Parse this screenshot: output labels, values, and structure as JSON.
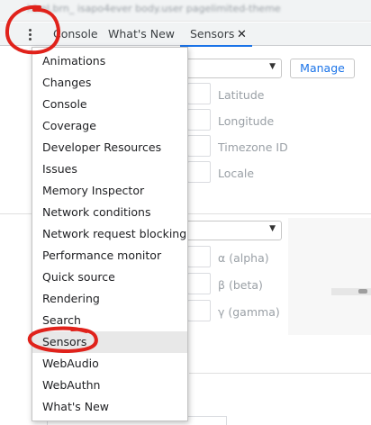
{
  "top_strip": {
    "breadcrumb_text": "html.brn_ isapo4ever  body.user pagelimited-theme"
  },
  "tabs": [
    {
      "label": "Console"
    },
    {
      "label": "What's New"
    },
    {
      "label": "Sensors",
      "close": "✕"
    }
  ],
  "sensors": {
    "manage_label": "Manage",
    "location_fields": [
      "Latitude",
      "Longitude",
      "Timezone ID",
      "Locale"
    ],
    "orientation_fields": [
      "α (alpha)",
      "β (beta)",
      "γ (gamma)"
    ],
    "dropdown_arrow": "▼"
  },
  "menu": {
    "items": [
      "Animations",
      "Changes",
      "Console",
      "Coverage",
      "Developer Resources",
      "Issues",
      "Memory Inspector",
      "Network conditions",
      "Network request blocking",
      "Performance monitor",
      "Quick source",
      "Rendering",
      "Search",
      "Sensors",
      "WebAudio",
      "WebAuthn",
      "What's New"
    ],
    "highlighted": "Sensors"
  },
  "colors": {
    "accent": "#1a73e8",
    "annotation": "#e0221b",
    "highlight": "#e8e8e8"
  },
  "icons": {
    "kebab": "vertical-dots-icon",
    "close": "close-icon"
  }
}
